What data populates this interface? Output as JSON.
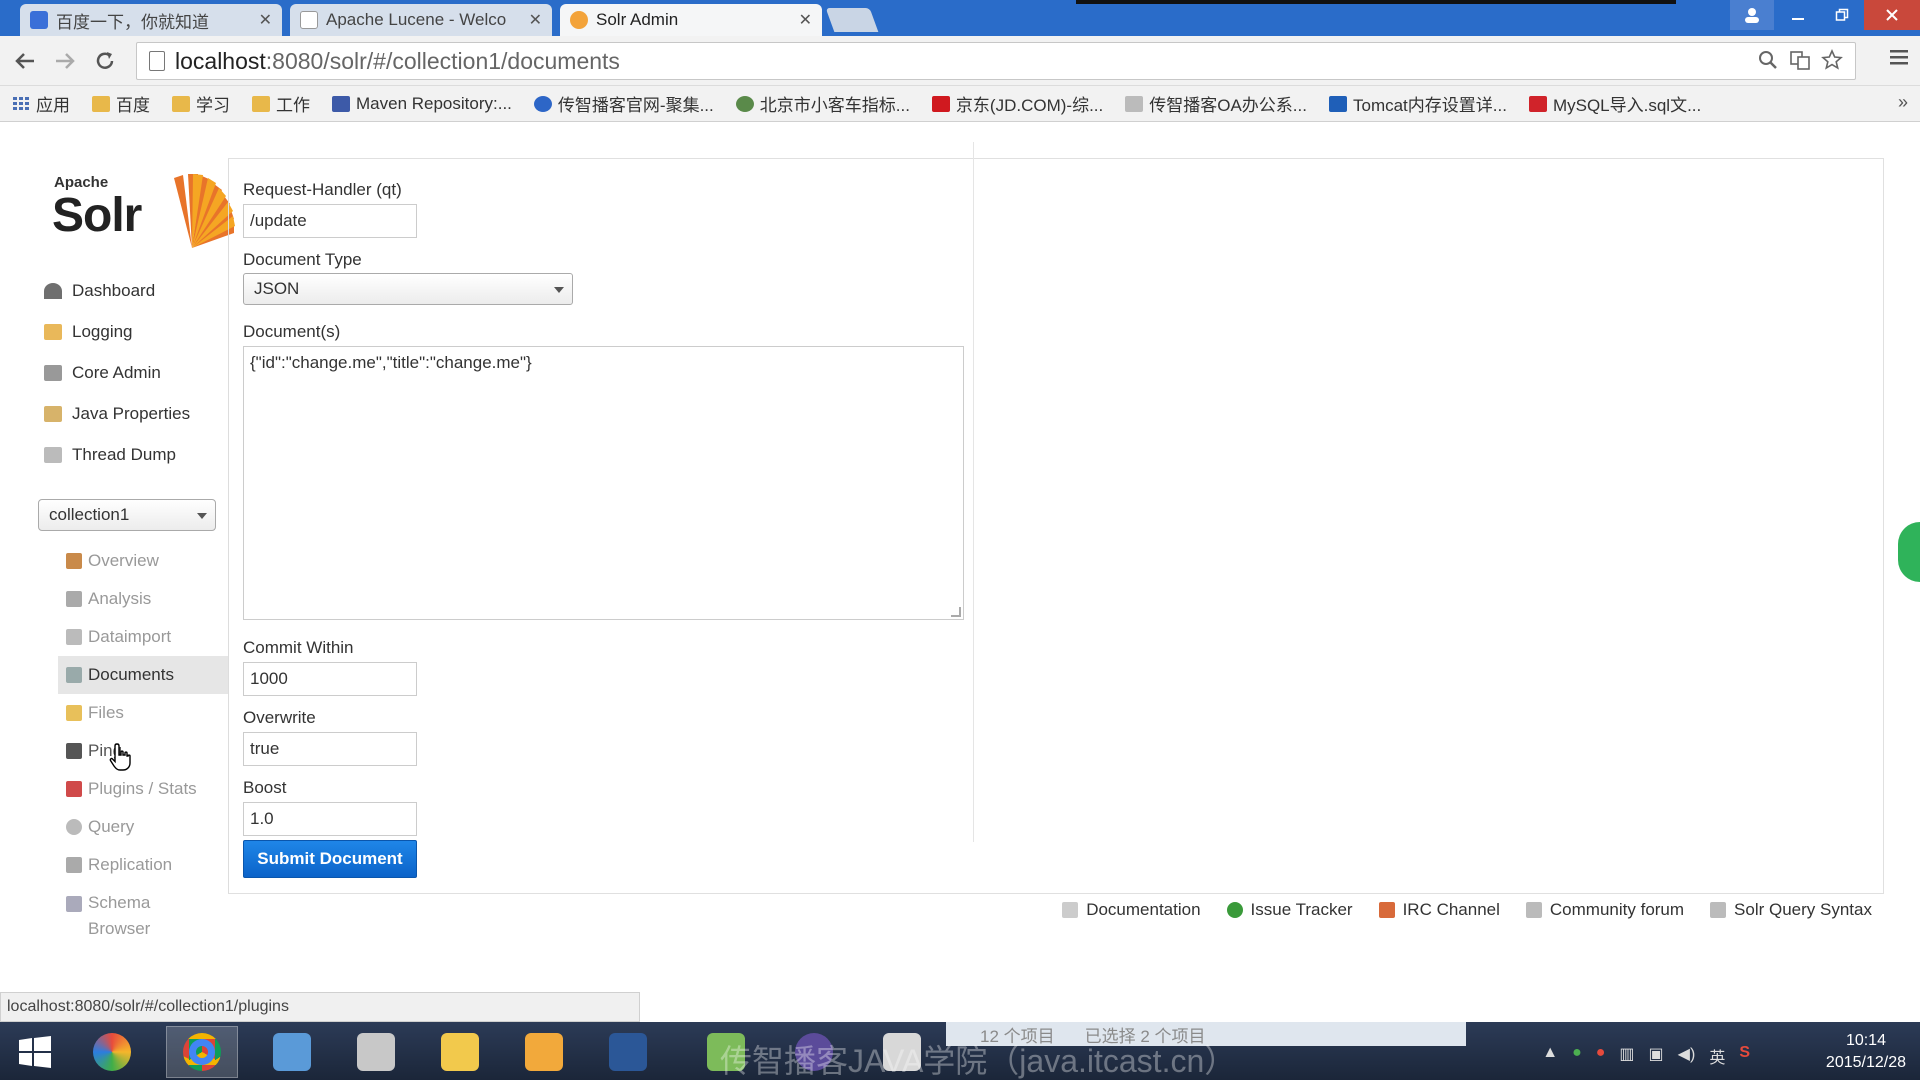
{
  "browser": {
    "tabs": [
      {
        "label": "百度一下，你就知道",
        "icon": "baidu-icon",
        "active": false
      },
      {
        "label": "Apache Lucene - Welco",
        "icon": "page-icon",
        "active": false
      },
      {
        "label": "Solr Admin",
        "icon": "solr-icon",
        "active": true
      }
    ],
    "tab_close": "✕",
    "url_host": "localhost",
    "url_rest": ":8080/solr/#/collection1/documents",
    "bookmarks": [
      {
        "label": "应用",
        "icon": "apps-grid-icon"
      },
      {
        "label": "百度",
        "icon": "folder-icon"
      },
      {
        "label": "学习",
        "icon": "folder-icon"
      },
      {
        "label": "工作",
        "icon": "folder-icon"
      },
      {
        "label": "Maven Repository:...",
        "icon": "maven-icon"
      },
      {
        "label": "传智播客官网-聚集...",
        "icon": "itcast-icon"
      },
      {
        "label": "北京市小客车指标...",
        "icon": "beijing-icon"
      },
      {
        "label": "京东(JD.COM)-综...",
        "icon": "jd-icon"
      },
      {
        "label": "传智播客OA办公系...",
        "icon": "oa-icon"
      },
      {
        "label": "Tomcat内存设置详...",
        "icon": "tomcat-icon"
      },
      {
        "label": "MySQL导入.sql文...",
        "icon": "mysql-icon"
      }
    ],
    "bookmark_more": "»"
  },
  "solr": {
    "logo_small": "Apache",
    "logo_big": "Solr",
    "nav": [
      {
        "label": "Dashboard",
        "icon": "dashboard-icon"
      },
      {
        "label": "Logging",
        "icon": "logging-icon"
      },
      {
        "label": "Core Admin",
        "icon": "core-admin-icon"
      },
      {
        "label": "Java Properties",
        "icon": "java-properties-icon"
      },
      {
        "label": "Thread Dump",
        "icon": "thread-dump-icon"
      }
    ],
    "core_selector": "collection1",
    "core_menu": [
      {
        "label": "Overview",
        "icon": "overview-icon"
      },
      {
        "label": "Analysis",
        "icon": "analysis-icon"
      },
      {
        "label": "Dataimport",
        "icon": "dataimport-icon"
      },
      {
        "label": "Documents",
        "icon": "documents-icon",
        "active": true
      },
      {
        "label": "Files",
        "icon": "files-icon"
      },
      {
        "label": "Ping",
        "icon": "ping-icon"
      },
      {
        "label": "Plugins / Stats",
        "icon": "plugins-icon"
      },
      {
        "label": "Query",
        "icon": "query-icon"
      },
      {
        "label": "Replication",
        "icon": "replication-icon"
      },
      {
        "label": "Schema\nBrowser",
        "icon": "schema-browser-icon"
      }
    ],
    "form": {
      "request_handler_label": "Request-Handler (qt)",
      "request_handler_value": "/update",
      "document_type_label": "Document Type",
      "document_type_value": "JSON",
      "documents_label": "Document(s)",
      "documents_value": "{\"id\":\"change.me\",\"title\":\"change.me\"}",
      "commit_within_label": "Commit Within",
      "commit_within_value": "1000",
      "overwrite_label": "Overwrite",
      "overwrite_value": "true",
      "boost_label": "Boost",
      "boost_value": "1.0",
      "submit_label": "Submit Document"
    },
    "footer": [
      {
        "label": "Documentation",
        "icon": "documentation-icon"
      },
      {
        "label": "Issue Tracker",
        "icon": "issue-tracker-icon"
      },
      {
        "label": "IRC Channel",
        "icon": "irc-channel-icon"
      },
      {
        "label": "Community forum",
        "icon": "community-forum-icon"
      },
      {
        "label": "Solr Query Syntax",
        "icon": "query-syntax-icon"
      }
    ]
  },
  "status_url": "localhost:8080/solr/#/collection1/plugins",
  "taskbar": {
    "explorer_items": "12 个项目",
    "explorer_selected": "已选择 2 个项目",
    "watermark": "传智播客JAVA学院（java.itcast.cn）",
    "time": "10:14",
    "date": "2015/12/28",
    "ime": "英"
  },
  "colors": {
    "accent": "#0b63c9",
    "tabbar": "#2a6cc9",
    "active_nav": "#e6e6e6"
  }
}
